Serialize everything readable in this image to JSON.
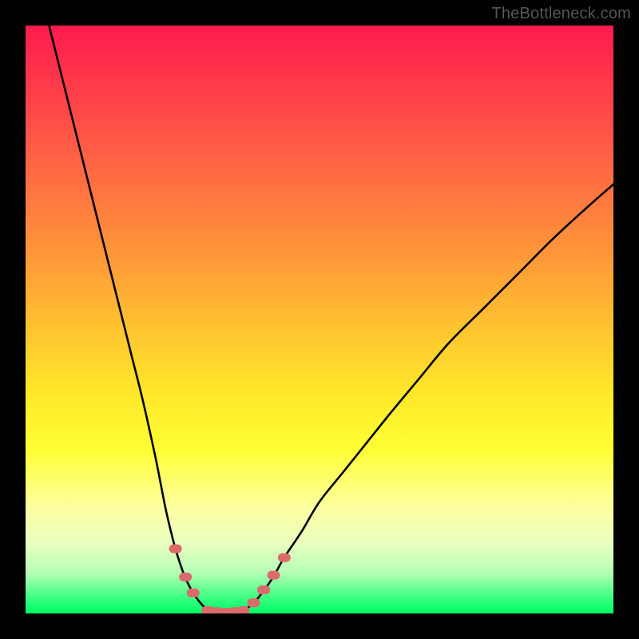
{
  "attribution": "TheBottleneck.com",
  "colors": {
    "gradient_top": "#ff1a4e",
    "gradient_mid": "#ffff33",
    "gradient_bottom": "#00ff66",
    "curve": "#000000",
    "marker": "#db6b6b",
    "frame": "#000000"
  },
  "chart_data": {
    "type": "line",
    "title": "",
    "xlabel": "",
    "ylabel": "",
    "xlim": [
      0,
      100
    ],
    "ylim": [
      0,
      100
    ],
    "grid": false,
    "legend": false,
    "annotations": [
      "TheBottleneck.com"
    ],
    "series": [
      {
        "name": "left-branch",
        "x": [
          4,
          6,
          8,
          10,
          12,
          14,
          16,
          18,
          20,
          22,
          23,
          24,
          25.5,
          27,
          28.5,
          30,
          31
        ],
        "values": [
          100,
          92,
          84,
          76,
          68,
          60,
          52,
          44,
          36,
          27,
          22,
          17,
          11,
          6.5,
          3.5,
          1.5,
          0.5
        ]
      },
      {
        "name": "right-branch",
        "x": [
          37,
          38.5,
          40,
          42,
          44,
          47,
          50,
          54,
          58,
          62,
          67,
          72,
          78,
          84,
          90,
          96,
          100
        ],
        "values": [
          0.5,
          1.5,
          3.2,
          6,
          9.5,
          14,
          19,
          24,
          29,
          34,
          40,
          46,
          52,
          58,
          64,
          69.5,
          73
        ]
      },
      {
        "name": "trough-floor",
        "x": [
          31,
          32.5,
          34,
          35.5,
          37
        ],
        "values": [
          0.5,
          0.1,
          0.0,
          0.1,
          0.5
        ]
      }
    ],
    "markers": [
      {
        "series": "left-branch",
        "x": 25.5,
        "y": 11
      },
      {
        "series": "left-branch",
        "x": 27.2,
        "y": 6.2
      },
      {
        "series": "left-branch",
        "x": 28.5,
        "y": 3.5
      },
      {
        "series": "trough-floor",
        "x": 31,
        "y": 0.5
      },
      {
        "series": "trough-floor",
        "x": 32.5,
        "y": 0.3
      },
      {
        "series": "trough-floor",
        "x": 34,
        "y": 0.2
      },
      {
        "series": "trough-floor",
        "x": 35.5,
        "y": 0.3
      },
      {
        "series": "trough-floor",
        "x": 37,
        "y": 0.5
      },
      {
        "series": "right-branch",
        "x": 38.8,
        "y": 1.8
      },
      {
        "series": "right-branch",
        "x": 40.5,
        "y": 4
      },
      {
        "series": "right-branch",
        "x": 42.2,
        "y": 6.5
      },
      {
        "series": "right-branch",
        "x": 44,
        "y": 9.5
      }
    ],
    "marker_style": {
      "shape": "rounded-pill",
      "color": "#db6b6b"
    }
  }
}
